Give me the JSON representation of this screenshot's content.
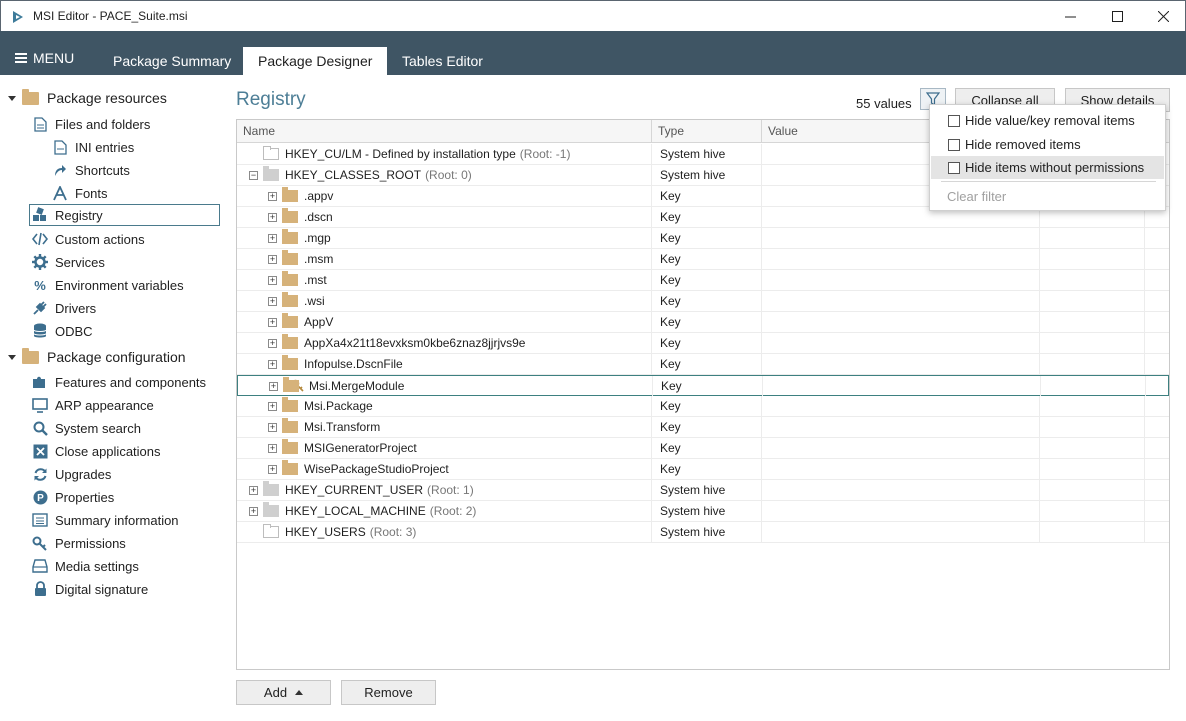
{
  "window": {
    "title": "MSI Editor - PACE_Suite.msi"
  },
  "ribbon": {
    "menu_label": "MENU",
    "tabs": [
      {
        "label": "Package Summary"
      },
      {
        "label": "Package Designer"
      },
      {
        "label": "Tables Editor"
      }
    ],
    "active_tab": "Package Designer"
  },
  "sidebar": {
    "resources": {
      "label": "Package resources",
      "items": [
        {
          "label": "Files and folders",
          "icon": "file-icon"
        },
        {
          "label": "INI entries",
          "icon": "ini-icon"
        },
        {
          "label": "Shortcuts",
          "icon": "shortcut-icon"
        },
        {
          "label": "Fonts",
          "icon": "font-icon"
        },
        {
          "label": "Registry",
          "icon": "registry-icon"
        },
        {
          "label": "Custom actions",
          "icon": "code-icon"
        },
        {
          "label": "Services",
          "icon": "gear-icon"
        },
        {
          "label": "Environment variables",
          "icon": "percent-icon"
        },
        {
          "label": "Drivers",
          "icon": "plug-icon"
        },
        {
          "label": "ODBC",
          "icon": "database-icon"
        }
      ]
    },
    "configuration": {
      "label": "Package configuration",
      "items": [
        {
          "label": "Features and components",
          "icon": "puzzle-icon"
        },
        {
          "label": "ARP appearance",
          "icon": "monitor-icon"
        },
        {
          "label": "System search",
          "icon": "search-icon"
        },
        {
          "label": "Close applications",
          "icon": "close-app-icon"
        },
        {
          "label": "Upgrades",
          "icon": "refresh-icon"
        },
        {
          "label": "Properties",
          "icon": "properties-icon"
        },
        {
          "label": "Summary information",
          "icon": "list-icon"
        },
        {
          "label": "Permissions",
          "icon": "key-icon"
        },
        {
          "label": "Media settings",
          "icon": "media-icon"
        },
        {
          "label": "Digital signature",
          "icon": "lock-icon"
        }
      ]
    },
    "selected": "Registry"
  },
  "main": {
    "title": "Registry",
    "values_count": "55 values",
    "collapse_all": "Collapse all",
    "show_details": "Show details",
    "columns": {
      "name": "Name",
      "type": "Type",
      "value": "Value"
    },
    "rows": [
      {
        "indent": 0,
        "expander": "",
        "folder": "empty",
        "name": "HKEY_CU/LM - Defined by installation type",
        "root": "(Root: -1)",
        "type": "System hive"
      },
      {
        "indent": 0,
        "expander": "−",
        "folder": "gray",
        "name": "HKEY_CLASSES_ROOT",
        "root": "(Root: 0)",
        "type": "System hive"
      },
      {
        "indent": 1,
        "expander": "+",
        "folder": "tan",
        "name": ".appv",
        "root": "",
        "type": "Key"
      },
      {
        "indent": 1,
        "expander": "+",
        "folder": "tan",
        "name": ".dscn",
        "root": "",
        "type": "Key"
      },
      {
        "indent": 1,
        "expander": "+",
        "folder": "tan",
        "name": ".mgp",
        "root": "",
        "type": "Key"
      },
      {
        "indent": 1,
        "expander": "+",
        "folder": "tan",
        "name": ".msm",
        "root": "",
        "type": "Key"
      },
      {
        "indent": 1,
        "expander": "+",
        "folder": "tan",
        "name": ".mst",
        "root": "",
        "type": "Key"
      },
      {
        "indent": 1,
        "expander": "+",
        "folder": "tan",
        "name": ".wsi",
        "root": "",
        "type": "Key"
      },
      {
        "indent": 1,
        "expander": "+",
        "folder": "tan",
        "name": "AppV",
        "root": "",
        "type": "Key"
      },
      {
        "indent": 1,
        "expander": "+",
        "folder": "tan",
        "name": "AppXa4x21t18evxksm0kbe6znaz8jjrjvs9e",
        "root": "",
        "type": "Key"
      },
      {
        "indent": 1,
        "expander": "+",
        "folder": "tan",
        "name": "Infopulse.DscnFile",
        "root": "",
        "type": "Key"
      },
      {
        "indent": 1,
        "expander": "+",
        "folder": "tan",
        "name": "Msi.MergeModule",
        "root": "",
        "type": "Key",
        "key_icon": true,
        "focused": true
      },
      {
        "indent": 1,
        "expander": "+",
        "folder": "tan",
        "name": "Msi.Package",
        "root": "",
        "type": "Key"
      },
      {
        "indent": 1,
        "expander": "+",
        "folder": "tan",
        "name": "Msi.Transform",
        "root": "",
        "type": "Key"
      },
      {
        "indent": 1,
        "expander": "+",
        "folder": "tan",
        "name": "MSIGeneratorProject",
        "root": "",
        "type": "Key"
      },
      {
        "indent": 1,
        "expander": "+",
        "folder": "tan",
        "name": "WisePackageStudioProject",
        "root": "",
        "type": "Key"
      },
      {
        "indent": 0,
        "expander": "+",
        "folder": "gray",
        "name": "HKEY_CURRENT_USER",
        "root": "(Root: 1)",
        "type": "System hive"
      },
      {
        "indent": 0,
        "expander": "+",
        "folder": "gray",
        "name": "HKEY_LOCAL_MACHINE",
        "root": "(Root: 2)",
        "type": "System hive"
      },
      {
        "indent": 0,
        "expander": "",
        "folder": "empty",
        "name": "HKEY_USERS",
        "root": "(Root: 3)",
        "type": "System hive"
      }
    ],
    "add_label": "Add",
    "remove_label": "Remove"
  },
  "filter_menu": {
    "options": [
      {
        "label": "Hide value/key removal items",
        "checked": false
      },
      {
        "label": "Hide removed items",
        "checked": false
      },
      {
        "label": "Hide items without permissions",
        "checked": false
      }
    ],
    "clear_label": "Clear filter"
  },
  "colors": {
    "ribbon_bg": "#3f5564",
    "accent": "#4d7e96",
    "folder_tan": "#d6b27a"
  }
}
